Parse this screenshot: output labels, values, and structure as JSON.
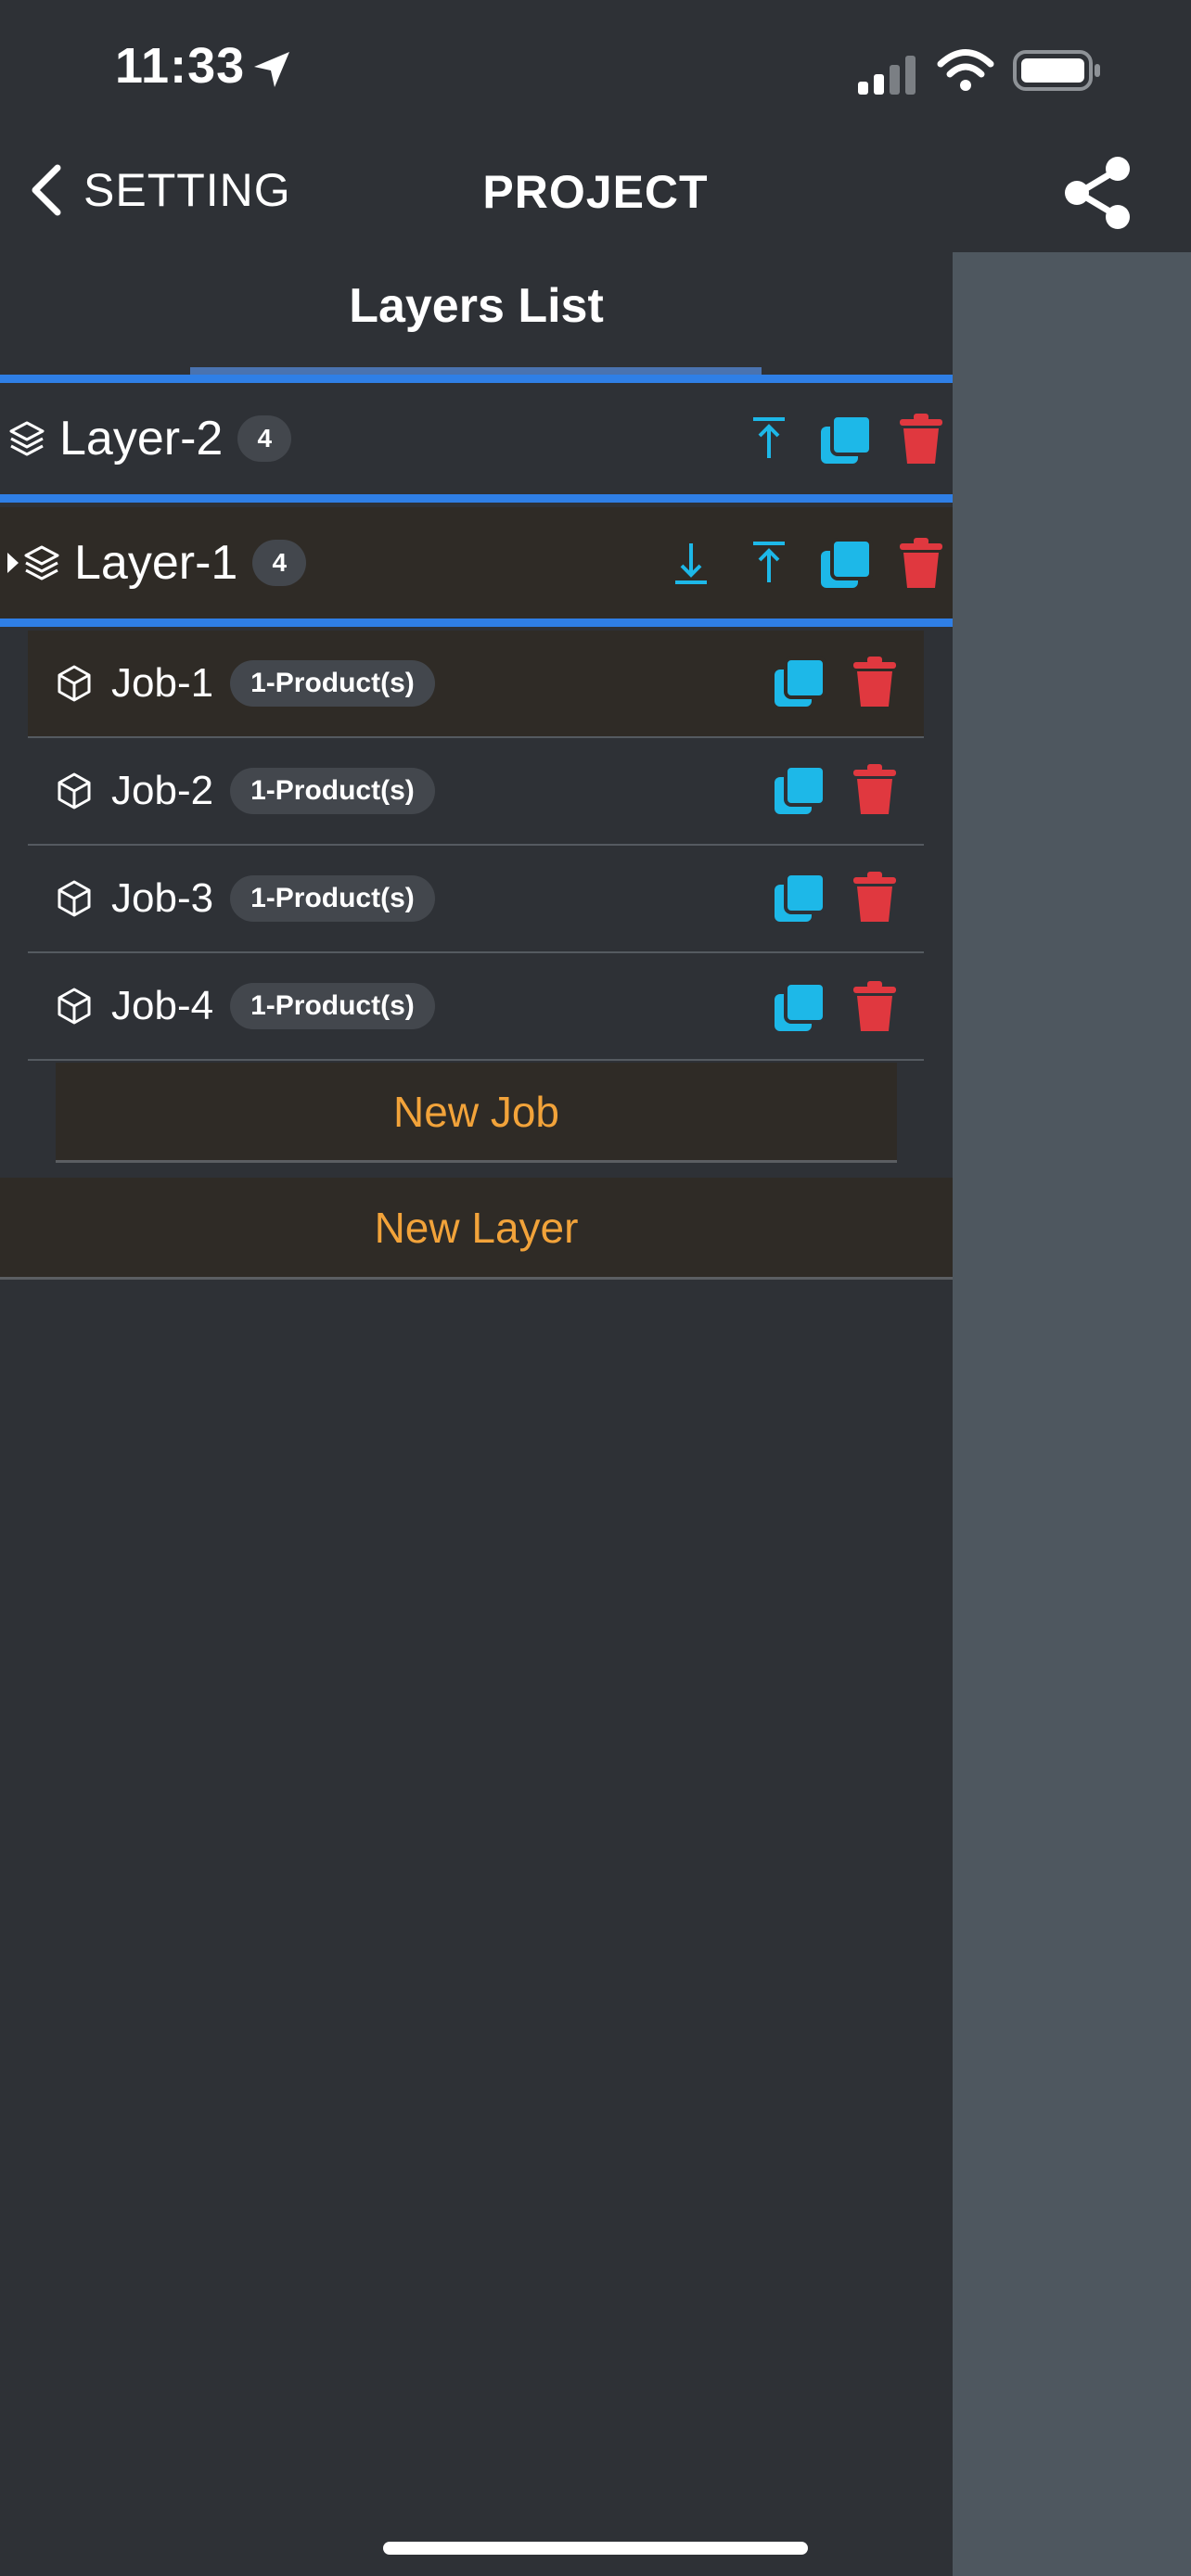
{
  "status_bar": {
    "time": "11:33"
  },
  "nav": {
    "back_label": "SETTING",
    "title": "PROJECT"
  },
  "list": {
    "title": "Layers List",
    "layers": [
      {
        "name": "Layer-2",
        "count": "4"
      },
      {
        "name": "Layer-1",
        "count": "4"
      }
    ],
    "jobs": [
      {
        "name": "Job-1",
        "badge": "1-Product(s)"
      },
      {
        "name": "Job-2",
        "badge": "1-Product(s)"
      },
      {
        "name": "Job-3",
        "badge": "1-Product(s)"
      },
      {
        "name": "Job-4",
        "badge": "1-Product(s)"
      }
    ],
    "new_job_label": "New Job",
    "new_layer_label": "New Layer"
  },
  "colors": {
    "background": "#2e3136",
    "accent_cyan": "#1db8e8",
    "delete_red": "#e0383f",
    "orange": "#f2a33a",
    "selection_blue": "#2f7fe6"
  }
}
